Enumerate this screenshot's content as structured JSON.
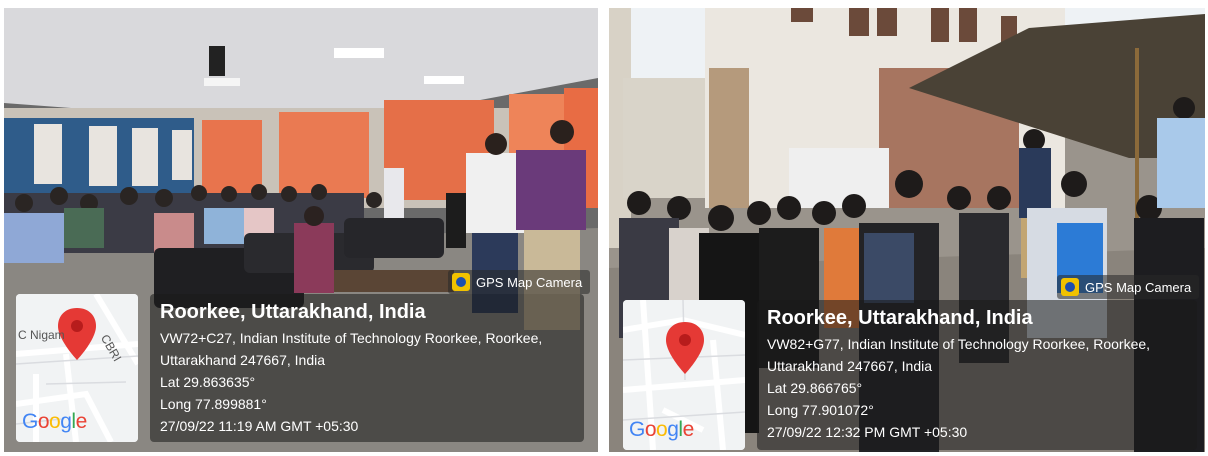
{
  "photos": [
    {
      "camera_badge": "GPS Map Camera",
      "map": {
        "street_1": "C Nigam",
        "street_2": "CBRI",
        "brand": "Google"
      },
      "location": {
        "city": "Roorkee, Uttarakhand, India",
        "address_line_1": "VW72+C27, Indian Institute of Technology Roorkee, Roorkee,",
        "address_line_2": "Uttarakhand 247667, India",
        "lat": "Lat 29.863635°",
        "long": "Long 77.899881°",
        "timestamp": "27/09/22 11:19 AM GMT +05:30"
      }
    },
    {
      "camera_badge": "GPS Map Camera",
      "map": {
        "brand": "Google"
      },
      "location": {
        "city": "Roorkee, Uttarakhand, India",
        "address_line_1": "VW82+G77, Indian Institute of Technology Roorkee, Roorkee,",
        "address_line_2": "Uttarakhand 247667, India",
        "lat": "Lat 29.866765°",
        "long": "Long 77.901072°",
        "timestamp": "27/09/22 12:32 PM GMT +05:30"
      }
    }
  ],
  "colors": {
    "pin": "#e53935",
    "overlay": "#191919",
    "google_blue": "#4285F4",
    "google_red": "#EA4335",
    "google_yellow": "#FBBC05",
    "google_green": "#34A853"
  }
}
